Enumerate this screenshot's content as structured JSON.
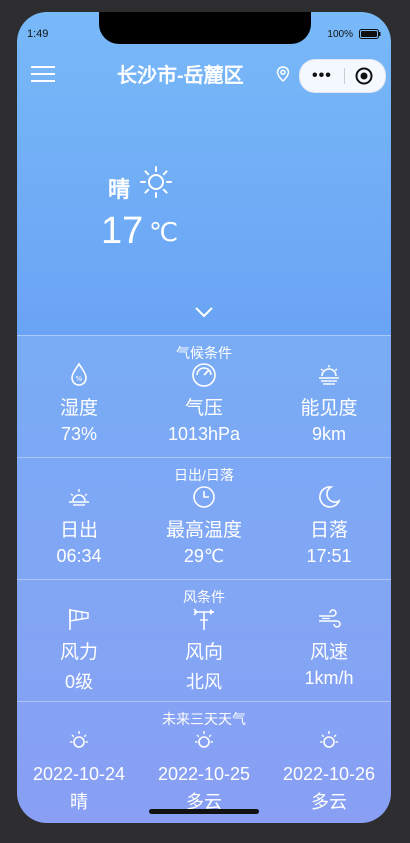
{
  "status": {
    "time": "1:49",
    "battery": "100%"
  },
  "header": {
    "title": "长沙市-岳麓区"
  },
  "current": {
    "condition": "晴",
    "temperature": "17",
    "unit": "℃"
  },
  "sections": {
    "climate": {
      "title": "气候条件",
      "items": [
        {
          "icon": "humidity-icon",
          "label": "湿度",
          "value": "73%"
        },
        {
          "icon": "pressure-gauge-icon",
          "label": "气压",
          "value": "1013hPa"
        },
        {
          "icon": "visibility-icon",
          "label": "能见度",
          "value": "9km"
        }
      ]
    },
    "sun": {
      "title": "日出/日落",
      "items": [
        {
          "icon": "sunrise-icon",
          "label": "日出",
          "value": "06:34"
        },
        {
          "icon": "clock-icon",
          "label": "最高温度",
          "value": "29℃"
        },
        {
          "icon": "moon-icon",
          "label": "日落",
          "value": "17:51"
        }
      ]
    },
    "wind": {
      "title": "风条件",
      "items": [
        {
          "icon": "windsock-icon",
          "label": "风力",
          "value": "0级"
        },
        {
          "icon": "wind-vane-icon",
          "label": "风向",
          "value": "北风"
        },
        {
          "icon": "wind-icon",
          "label": "风速",
          "value": "1km/h"
        }
      ]
    },
    "forecast": {
      "title": "未来三天天气",
      "items": [
        {
          "icon": "sun-icon",
          "date": "2022-10-24",
          "condition": "晴"
        },
        {
          "icon": "sun-icon",
          "date": "2022-10-25",
          "condition": "多云"
        },
        {
          "icon": "sun-icon",
          "date": "2022-10-26",
          "condition": "多云"
        }
      ]
    }
  }
}
